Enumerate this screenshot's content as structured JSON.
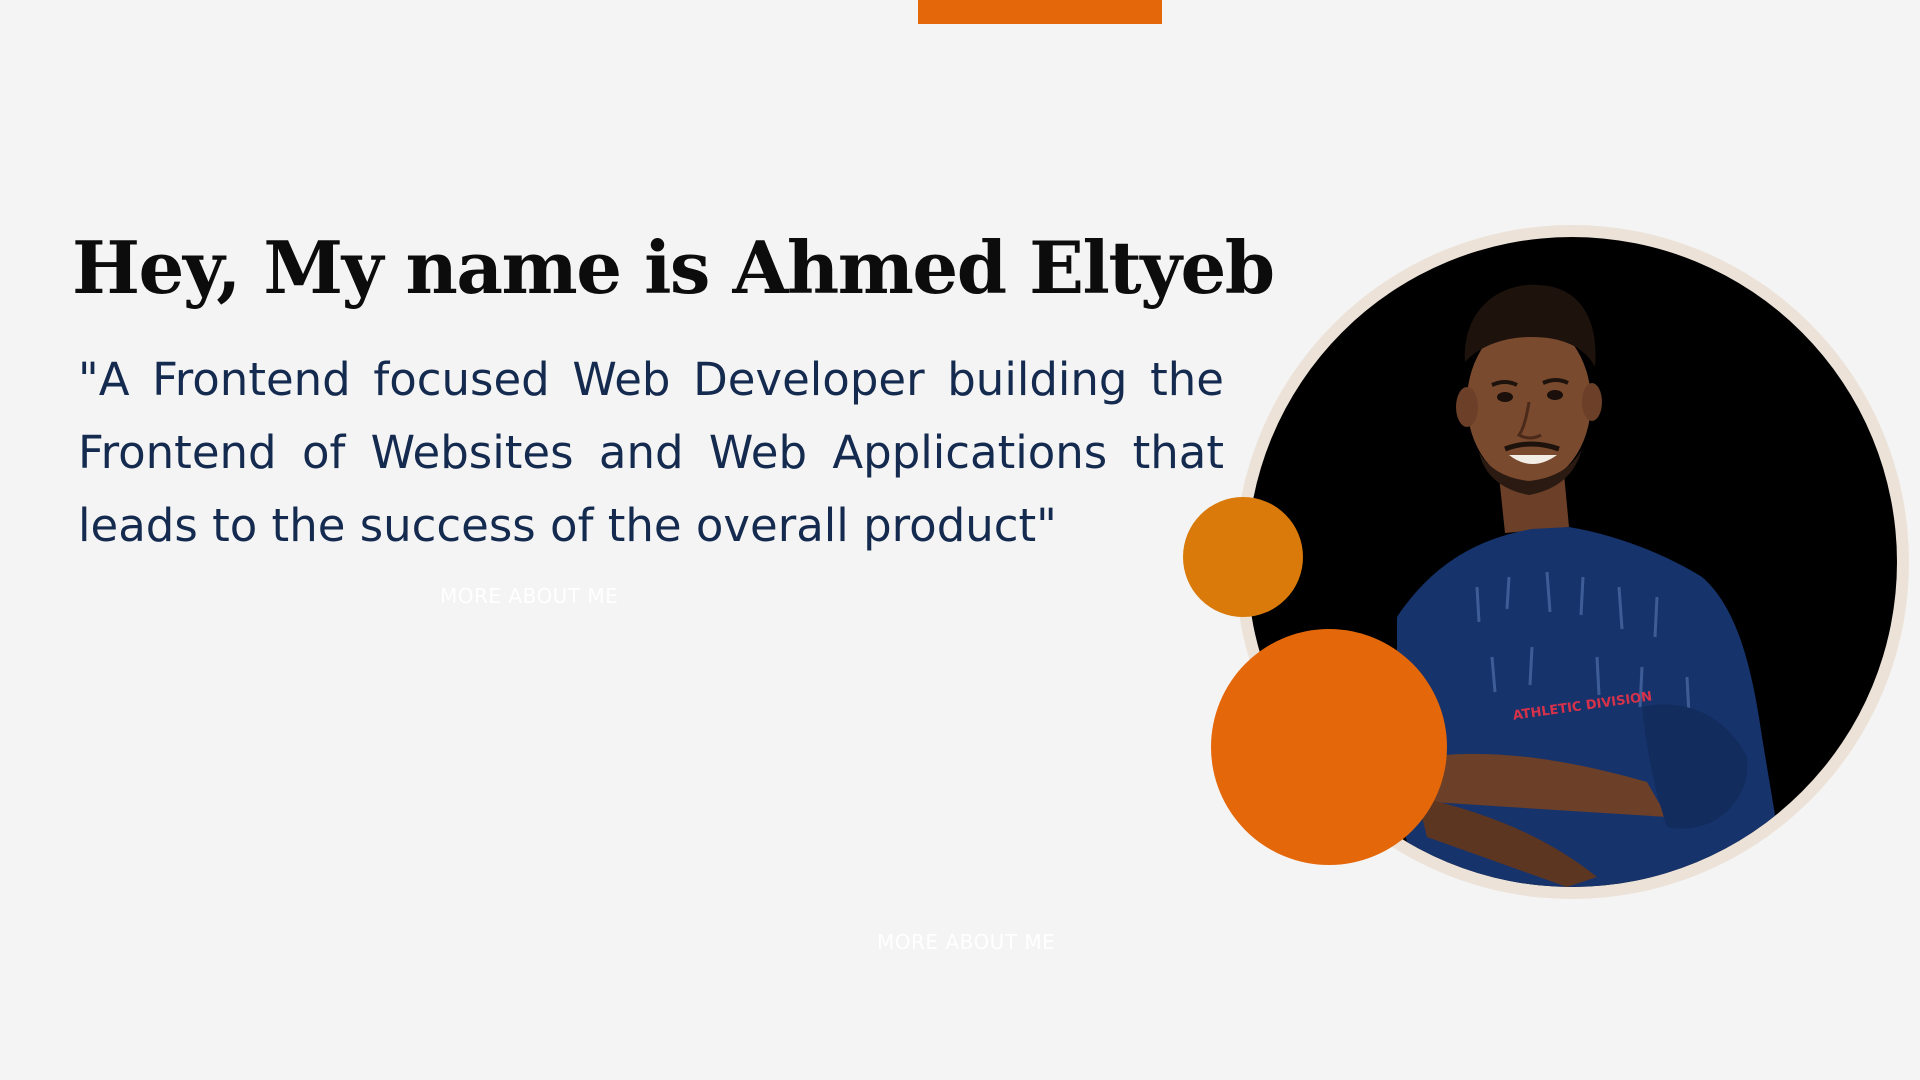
{
  "hero": {
    "title": "Hey, My name is Ahmed Eltyeb",
    "quote": "\"A Frontend focused Web Developer building the Frontend of Websites and Web Applications that leads to the success of the overall product\""
  },
  "links": {
    "more_about_me_primary": "MORE ABOUT ME",
    "more_about_me_secondary": "MORE ABOUT ME"
  },
  "portrait": {
    "shirt_text": "ATHLETIC DIVISION"
  },
  "colors": {
    "accent": "#e4670a",
    "accent_dark": "#d97a0a",
    "heading": "#0c0c0c",
    "quote_text": "#142a4f",
    "background": "#f4f4f4",
    "ring": "#ece2d8"
  }
}
